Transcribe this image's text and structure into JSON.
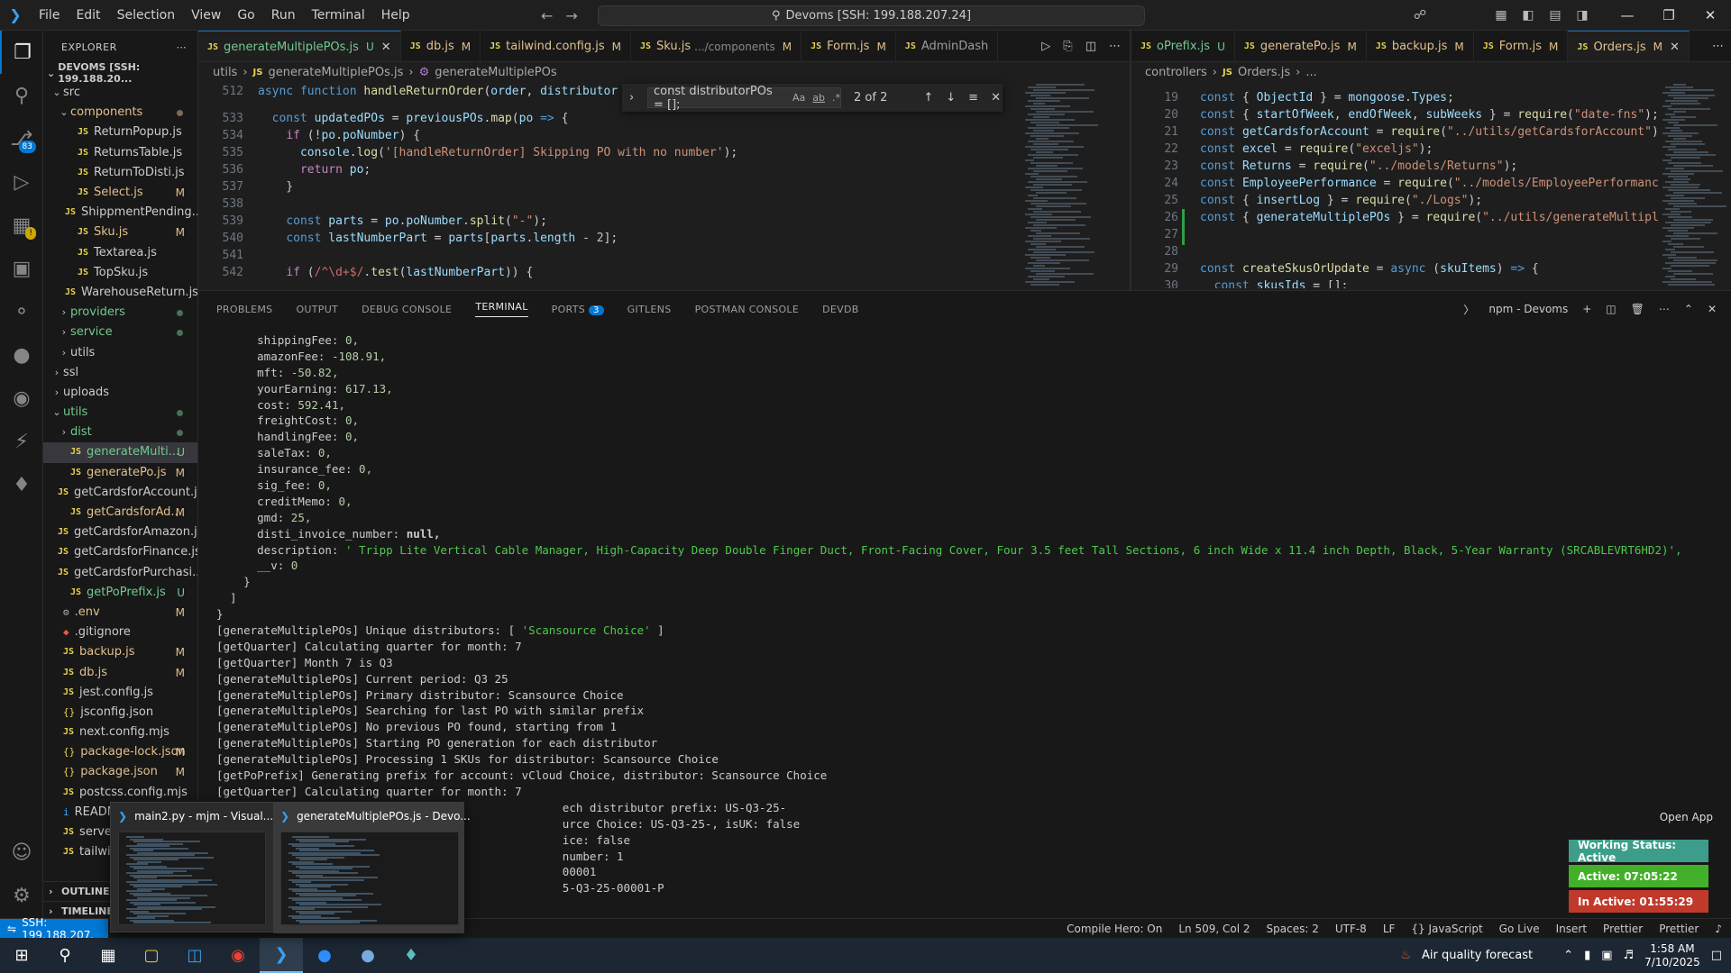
{
  "titlebar": {
    "menu": [
      "File",
      "Edit",
      "Selection",
      "View",
      "Go",
      "Run",
      "Terminal",
      "Help"
    ],
    "command_center": "Devoms [SSH: 199.188.207.24]"
  },
  "activity": {
    "scm_badge": "83"
  },
  "sidebar": {
    "title": "EXPLORER",
    "root": "DEVOMS [SSH: 199.188.20...",
    "items": [
      {
        "label": "src",
        "type": "folder-open",
        "indent": 0
      },
      {
        "label": "components",
        "type": "folder-open",
        "indent": 1,
        "state": "mod"
      },
      {
        "label": "ReturnPopup.js",
        "type": "js",
        "indent": 2
      },
      {
        "label": "ReturnsTable.js",
        "type": "js",
        "indent": 2
      },
      {
        "label": "ReturnToDisti.js",
        "type": "js",
        "indent": 2
      },
      {
        "label": "Select.js",
        "type": "js",
        "indent": 2,
        "state": "mod",
        "mark": "M"
      },
      {
        "label": "ShippmentPending...",
        "type": "js",
        "indent": 2
      },
      {
        "label": "Sku.js",
        "type": "js",
        "indent": 2,
        "state": "mod",
        "mark": "M"
      },
      {
        "label": "Textarea.js",
        "type": "js",
        "indent": 2
      },
      {
        "label": "TopSku.js",
        "type": "js",
        "indent": 2
      },
      {
        "label": "WarehouseReturn.js",
        "type": "js",
        "indent": 2
      },
      {
        "label": "providers",
        "type": "folder",
        "indent": 1,
        "state": "unt"
      },
      {
        "label": "service",
        "type": "folder",
        "indent": 1,
        "state": "unt"
      },
      {
        "label": "utils",
        "type": "folder",
        "indent": 1
      },
      {
        "label": "ssl",
        "type": "folder",
        "indent": 0
      },
      {
        "label": "uploads",
        "type": "folder",
        "indent": 0
      },
      {
        "label": "utils",
        "type": "folder-open",
        "indent": 0,
        "state": "unt"
      },
      {
        "label": "dist",
        "type": "folder",
        "indent": 1,
        "state": "unt"
      },
      {
        "label": "generateMulti...",
        "type": "js",
        "indent": 1,
        "state": "unt",
        "mark": "U",
        "selected": true
      },
      {
        "label": "generatePo.js",
        "type": "js",
        "indent": 1,
        "state": "mod",
        "mark": "M"
      },
      {
        "label": "getCardsforAccount.js",
        "type": "js",
        "indent": 1
      },
      {
        "label": "getCardsforAd...",
        "type": "js",
        "indent": 1,
        "state": "mod",
        "mark": "M"
      },
      {
        "label": "getCardsforAmazon.js",
        "type": "js",
        "indent": 1
      },
      {
        "label": "getCardsforFinance.js",
        "type": "js",
        "indent": 1
      },
      {
        "label": "getCardsforPurchasi...",
        "type": "js",
        "indent": 1
      },
      {
        "label": "getPoPrefix.js",
        "type": "js",
        "indent": 1,
        "state": "unt",
        "mark": "U"
      },
      {
        "label": ".env",
        "type": "gear",
        "indent": 0,
        "state": "mod",
        "mark": "M"
      },
      {
        "label": ".gitignore",
        "type": "diamond",
        "indent": 0
      },
      {
        "label": "backup.js",
        "type": "js",
        "indent": 0,
        "state": "mod",
        "mark": "M"
      },
      {
        "label": "db.js",
        "type": "js",
        "indent": 0,
        "state": "mod",
        "mark": "M"
      },
      {
        "label": "jest.config.js",
        "type": "js",
        "indent": 0
      },
      {
        "label": "jsconfig.json",
        "type": "json",
        "indent": 0
      },
      {
        "label": "next.config.mjs",
        "type": "js",
        "indent": 0
      },
      {
        "label": "package-lock.json",
        "type": "json",
        "indent": 0,
        "state": "mod",
        "mark": "M"
      },
      {
        "label": "package.json",
        "type": "json",
        "indent": 0,
        "state": "mod",
        "mark": "M"
      },
      {
        "label": "postcss.config.mjs",
        "type": "js",
        "indent": 0
      },
      {
        "label": "README...",
        "type": "info",
        "indent": 0
      },
      {
        "label": "server...",
        "type": "js",
        "indent": 0
      },
      {
        "label": "tailwin...",
        "type": "js",
        "indent": 0
      }
    ],
    "outline": "OUTLINE",
    "timeline": "TIMELINE"
  },
  "editor_left": {
    "tabs": [
      {
        "name": "generateMultiplePOs.js",
        "status": "U",
        "state": "unt",
        "active": true
      },
      {
        "name": "db.js",
        "status": "M",
        "state": "mod"
      },
      {
        "name": "tailwind.config.js",
        "status": "M",
        "state": "mod"
      },
      {
        "name": "Sku.js",
        "sub": ".../components",
        "status": "M",
        "state": "mod"
      },
      {
        "name": "Form.js",
        "status": "M",
        "state": "mod"
      },
      {
        "name": "AdminDash",
        "status": "",
        "state": ""
      }
    ],
    "breadcrumb": [
      "utils",
      "generateMultiplePOs.js",
      "generateMultiplePOs"
    ],
    "find": {
      "query": "const distributorPOs = [];",
      "count": "2 of 2"
    },
    "line_numbers": [
      "512",
      "533",
      "534",
      "535",
      "536",
      "537",
      "538",
      "539",
      "540",
      "541",
      "542"
    ]
  },
  "editor_right": {
    "tabs": [
      {
        "name": "oPrefix.js",
        "status": "U",
        "state": "unt"
      },
      {
        "name": "generatePo.js",
        "status": "M",
        "state": "mod"
      },
      {
        "name": "backup.js",
        "status": "M",
        "state": "mod"
      },
      {
        "name": "Form.js",
        "status": "M",
        "state": "mod"
      },
      {
        "name": "Orders.js",
        "status": "M",
        "state": "mod",
        "active": true
      }
    ],
    "breadcrumb": [
      "controllers",
      "Orders.js",
      "..."
    ],
    "line_numbers": [
      "19",
      "20",
      "21",
      "22",
      "23",
      "24",
      "25",
      "26",
      "27",
      "28",
      "29",
      "30"
    ]
  },
  "panel": {
    "tabs": [
      "PROBLEMS",
      "OUTPUT",
      "DEBUG CONSOLE",
      "TERMINAL",
      "PORTS",
      "GITLENS",
      "POSTMAN CONSOLE",
      "DEVDB"
    ],
    "active_tab": "TERMINAL",
    "ports_badge": "3",
    "terminal_name": "npm - Devoms"
  },
  "terminal_lines": [
    "      shippingFee: 0,",
    "      amazonFee: -108.91,",
    "      mft: -50.82,",
    "      yourEarning: 617.13,",
    "      cost: 592.41,",
    "      freightCost: 0,",
    "      handlingFee: 0,",
    "      saleTax: 0,",
    "      insurance_fee: 0,",
    "      sig_fee: 0,",
    "      creditMemo: 0,",
    "      gmd: 25,",
    "      disti_invoice_number: null,",
    "      description: ' Tripp Lite Vertical Cable Manager, High-Capacity Deep Double Finger Duct, Front-Facing Cover, Four 3.5 feet Tall Sections, 6 inch Wide x 11.4 inch Depth, Black, 5-Year Warranty (SRCABLEVRT6HD2)',",
    "      __v: 0",
    "    }",
    "  ]",
    "}",
    "[generateMultiplePOs] Unique distributors: [ 'Scansource Choice' ]",
    "[getQuarter] Calculating quarter for month: 7",
    "[getQuarter] Month 7 is Q3",
    "[generateMultiplePOs] Current period: Q3 25",
    "[generateMultiplePOs] Primary distributor: Scansource Choice",
    "[generateMultiplePOs] Searching for last PO with similar prefix",
    "[generateMultiplePOs] No previous PO found, starting from 1",
    "[generateMultiplePOs] Starting PO generation for each distributor",
    "[generateMultiplePOs] Processing 1 SKUs for distributor: Scansource Choice",
    "[getPoPrefix] Generating prefix for account: vCloud Choice, distributor: Scansource Choice",
    "[getQuarter] Calculating quarter for month: 7",
    "                                                   ech distributor prefix: US-Q3-25-",
    "                                                   urce Choice: US-Q3-25-, isUK: false",
    "                                                   ice: false",
    "                                                   number: 1",
    "                                                   00001",
    "                                                   5-Q3-25-00001-P"
  ],
  "statusbar": {
    "remote": "SSH: 199.188.207.",
    "items": [
      "Compile Hero: On",
      "Ln 509, Col 2",
      "Spaces: 2",
      "UTF-8",
      "LF",
      "{} JavaScript",
      "Go Live",
      "Insert",
      "Prettier",
      "Prettier"
    ]
  },
  "taskbar": {
    "weather": "Air quality forecast",
    "time": "1:58 AM",
    "date": "7/10/2025"
  },
  "thumbnails": [
    {
      "title": "main2.py - mjm - Visual..."
    },
    {
      "title": "generateMultiplePOs.js - Devo..."
    }
  ],
  "work_status": {
    "open_app": "Open App",
    "status": "Working Status: Active",
    "active": "Active: 07:05:22",
    "inactive": "In Active: 01:55:29",
    "colors": {
      "status": "#3c9e8a",
      "active": "#43b02a",
      "inactive": "#c0392b"
    }
  }
}
